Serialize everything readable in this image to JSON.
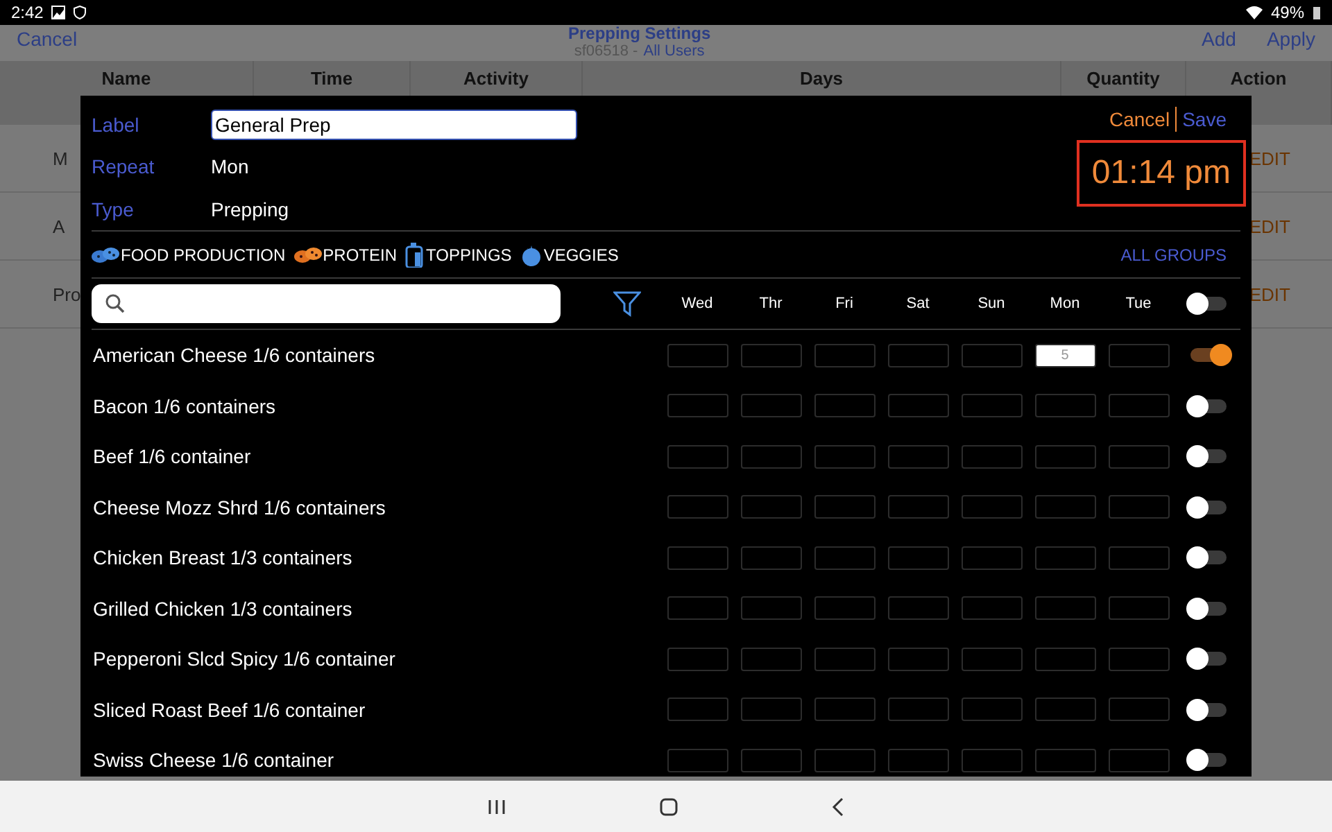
{
  "status_bar": {
    "time": "2:42",
    "battery": "49%"
  },
  "background": {
    "cancel": "Cancel",
    "title": "Prepping Settings",
    "subtitle": "sf06518 -",
    "users": "All Users",
    "add": "Add",
    "apply": "Apply",
    "columns": [
      "Name",
      "Time",
      "Activity",
      "Days",
      "Quantity",
      "Action"
    ],
    "rows": [
      {
        "name": "M",
        "action": "EDIT"
      },
      {
        "name": "A",
        "action": "EDIT"
      },
      {
        "name": "Pro",
        "action": "EDIT"
      }
    ]
  },
  "dialog": {
    "cancel": "Cancel",
    "save": "Save",
    "time": "01:14 pm",
    "fields": [
      {
        "label": "Label",
        "value": "General Prep",
        "kind": "input"
      },
      {
        "label": "Repeat",
        "value": "Mon",
        "kind": "text"
      },
      {
        "label": "Type",
        "value": "Prepping",
        "kind": "text"
      }
    ],
    "groups": [
      {
        "label": "FOOD PRODUCTION",
        "kind": "food"
      },
      {
        "label": "PROTEIN",
        "kind": "protein"
      },
      {
        "label": "TOPPINGS",
        "kind": "toppings"
      },
      {
        "label": "VEGGIES",
        "kind": "veggies"
      }
    ],
    "all_groups": "ALL GROUPS",
    "days": [
      "Wed",
      "Thr",
      "Fri",
      "Sat",
      "Sun",
      "Mon",
      "Tue"
    ],
    "all_on": false,
    "items": [
      {
        "name": "American Cheese 1/6 containers",
        "on": true,
        "cells": [
          null,
          null,
          null,
          null,
          null,
          "5",
          null
        ]
      },
      {
        "name": "Bacon 1/6 containers",
        "on": false,
        "cells": [
          null,
          null,
          null,
          null,
          null,
          null,
          null
        ]
      },
      {
        "name": "Beef 1/6 container",
        "on": false,
        "cells": [
          null,
          null,
          null,
          null,
          null,
          null,
          null
        ]
      },
      {
        "name": "Cheese Mozz Shrd 1/6 containers",
        "on": false,
        "cells": [
          null,
          null,
          null,
          null,
          null,
          null,
          null
        ]
      },
      {
        "name": "Chicken Breast 1/3 containers",
        "on": false,
        "cells": [
          null,
          null,
          null,
          null,
          null,
          null,
          null
        ]
      },
      {
        "name": "Grilled Chicken 1/3 containers",
        "on": false,
        "cells": [
          null,
          null,
          null,
          null,
          null,
          null,
          null
        ]
      },
      {
        "name": "Pepperoni Slcd Spicy 1/6 container",
        "on": false,
        "cells": [
          null,
          null,
          null,
          null,
          null,
          null,
          null
        ]
      },
      {
        "name": "Sliced Roast Beef 1/6 container",
        "on": false,
        "cells": [
          null,
          null,
          null,
          null,
          null,
          null,
          null
        ]
      },
      {
        "name": "Swiss Cheese 1/6 container",
        "on": false,
        "cells": [
          null,
          null,
          null,
          null,
          null,
          null,
          null
        ]
      }
    ]
  }
}
